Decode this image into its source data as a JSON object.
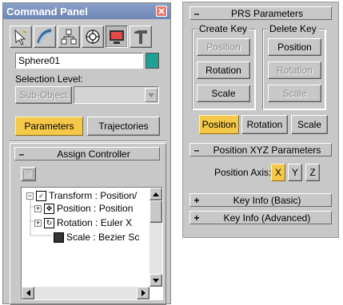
{
  "command_panel": {
    "title": "Command Panel",
    "object_name": "Sphere01",
    "object_color": "#20a090",
    "selection_level_label": "Selection Level:",
    "sub_object_label": "Sub-Object",
    "tabs": [
      "Parameters",
      "Trajectories"
    ],
    "icons": [
      "create-icon",
      "modify-icon",
      "hierarchy-icon",
      "motion-icon",
      "display-icon",
      "utilities-icon"
    ]
  },
  "assign_controller": {
    "rollout_sign": "–",
    "title": "Assign Controller",
    "tree": [
      {
        "label": "Transform : Position/"
      },
      {
        "label": "Position : Position"
      },
      {
        "label": "Rotation : Euler X"
      },
      {
        "label": "Scale : Bezier Sc"
      }
    ]
  },
  "prs": {
    "rollout_sign": "–",
    "title": "PRS Parameters",
    "create_key_label": "Create Key",
    "delete_key_label": "Delete Key",
    "create_key_buttons": [
      "Position",
      "Rotation",
      "Scale"
    ],
    "delete_key_buttons": [
      "Position",
      "Rotation",
      "Scale"
    ],
    "mode_buttons": [
      "Position",
      "Rotation",
      "Scale"
    ]
  },
  "position_xyz": {
    "rollout_sign": "–",
    "title": "Position XYZ Parameters",
    "axis_label": "Position Axis:",
    "axes": [
      "X",
      "Y",
      "Z"
    ]
  },
  "key_info_basic": {
    "rollout_sign": "+",
    "title": "Key Info (Basic)"
  },
  "key_info_advanced": {
    "rollout_sign": "+",
    "title": "Key Info (Advanced)"
  }
}
